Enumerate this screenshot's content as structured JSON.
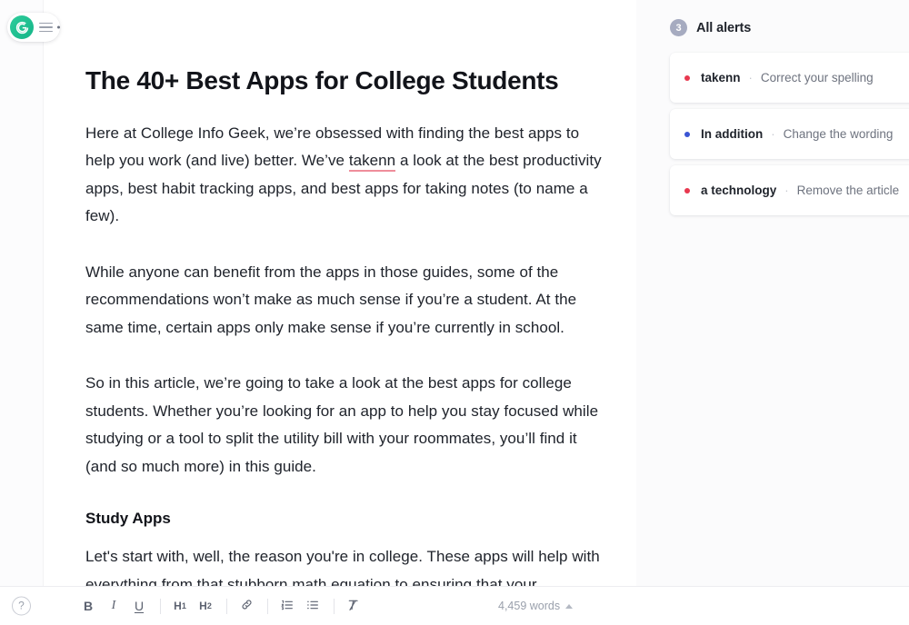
{
  "brand": {
    "logo_letter": "G",
    "logo_color": "#15b588",
    "menu_icon": "list-menu-icon"
  },
  "document": {
    "title": "The 40+ Best Apps for College Students",
    "paragraph_1_before": "Here at College Info Geek, we’re obsessed with finding the best apps to help you work (and live) better. We’ve ",
    "paragraph_1_error": "takenn",
    "paragraph_1_after": " a look at the best productivity apps, best habit tracking apps, and best apps for taking notes (to name a few).",
    "paragraph_2": "While anyone can benefit from the apps in those guides, some of the recommendations won’t make as much sense if you’re a student. At the same time, certain apps only make sense if you’re currently in school.",
    "paragraph_3": "So in this article, we’re going to take a look at the best apps for college students. Whether you’re looking for an app to help you stay focused while studying or a tool to split the utility bill with your roommates, you’ll find it (and so much more) in this guide.",
    "heading_2": "Study Apps",
    "paragraph_4": "Let's start with, well, the reason you're in college. These apps will help with everything from that stubborn math equation to ensuring that your"
  },
  "toolbar": {
    "help_label": "?",
    "bold_label": "B",
    "italic_label": "I",
    "underline_label": "U",
    "h1_label": "H",
    "h1_sub": "1",
    "h2_label": "H",
    "h2_sub": "2",
    "link_label": "link-icon",
    "ordered_list_label": "ordered-list-icon",
    "bullet_list_label": "bullet-list-icon",
    "clear_format_label": "clear-formatting-icon",
    "word_count": "4,459 words"
  },
  "panel": {
    "alert_count": "3",
    "title": "All alerts",
    "alerts": [
      {
        "target": "takenn",
        "separator": "·",
        "action": "Correct your spelling",
        "dot_color": "#e8384f",
        "type": "spelling"
      },
      {
        "target": "In addition",
        "separator": "·",
        "action": "Change the wording",
        "dot_color": "#3a55d4",
        "type": "clarity"
      },
      {
        "target": "a technology",
        "separator": "·",
        "action": "Remove the article",
        "dot_color": "#e8384f",
        "type": "grammar"
      }
    ]
  }
}
